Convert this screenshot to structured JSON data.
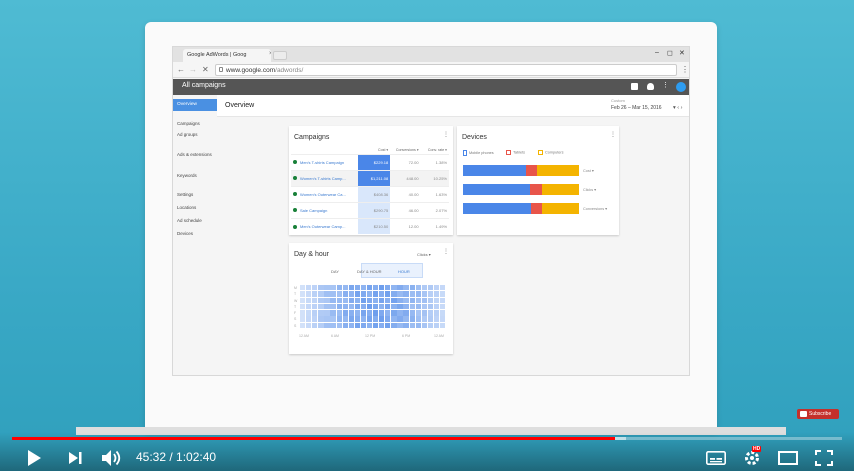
{
  "browser": {
    "tab_title": "Google AdWords | Goog",
    "tab_close": "×",
    "url_domain": "www.google.com",
    "url_path": "/adwords/"
  },
  "appbar": {
    "title": "All campaigns"
  },
  "sidebar": {
    "selected": "Overview",
    "items": [
      "Campaigns",
      "Ad groups",
      "Ads & extensions",
      "Keywords",
      "Settings",
      "Locations",
      "Ad schedule",
      "Devices"
    ]
  },
  "overview": {
    "title": "Overview",
    "date_label": "Custom",
    "date_range": "Feb 26 – Mar 15, 2016"
  },
  "campaigns_card": {
    "title": "Campaigns",
    "columns": [
      "Cost ▾",
      "Conversions ▾",
      "Conv. rate ▾"
    ],
    "rows": [
      {
        "name": "Men's T-shirts Campaign",
        "cost": "$229.18",
        "conversions": "72.00",
        "conv_rate": "1.38%"
      },
      {
        "name": "Women's T-shirts Camp...",
        "cost": "$1,211.08",
        "conversions": "448.00",
        "conv_rate": "10.25%"
      },
      {
        "name": "Women's Outerwear Ca...",
        "cost": "$408.36",
        "conversions": "40.00",
        "conv_rate": "1.63%"
      },
      {
        "name": "Sale Campaign",
        "cost": "$290.75",
        "conversions": "46.00",
        "conv_rate": "2.07%"
      },
      {
        "name": "Men's Outerwear Camp...",
        "cost": "$210.50",
        "conversions": "12.00",
        "conv_rate": "1.49%"
      }
    ]
  },
  "devices_card": {
    "title": "Devices",
    "legend": [
      "Mobile phones",
      "Tablets",
      "Computers"
    ],
    "colors": {
      "mobile": "#4a86e8",
      "tablet": "#e8554a",
      "computer": "#f4b400"
    },
    "bars": [
      {
        "label": "Cost ▾",
        "mobile": 0.54,
        "tablet": 0.1,
        "computer": 0.36
      },
      {
        "label": "Clicks ▾",
        "mobile": 0.58,
        "tablet": 0.1,
        "computer": 0.32
      },
      {
        "label": "Conversions ▾",
        "mobile": 0.59,
        "tablet": 0.09,
        "computer": 0.32
      }
    ]
  },
  "dayhour_card": {
    "title": "Day & hour",
    "metric": "Clicks ▾",
    "tabs": [
      "DAY",
      "DAY & HOUR",
      "HOUR"
    ],
    "x_ticks": [
      "12 AM",
      "6 AM",
      "12 PM",
      "6 PM",
      "12 AM"
    ],
    "y_ticks": [
      "M",
      "T",
      "W",
      "T",
      "F",
      "S",
      "S"
    ]
  },
  "player": {
    "timecode": "45:32 / 1:02:40",
    "progress": 0.726,
    "buffered": 0.74,
    "subscribe": "Subscribe",
    "hd": "HD"
  }
}
